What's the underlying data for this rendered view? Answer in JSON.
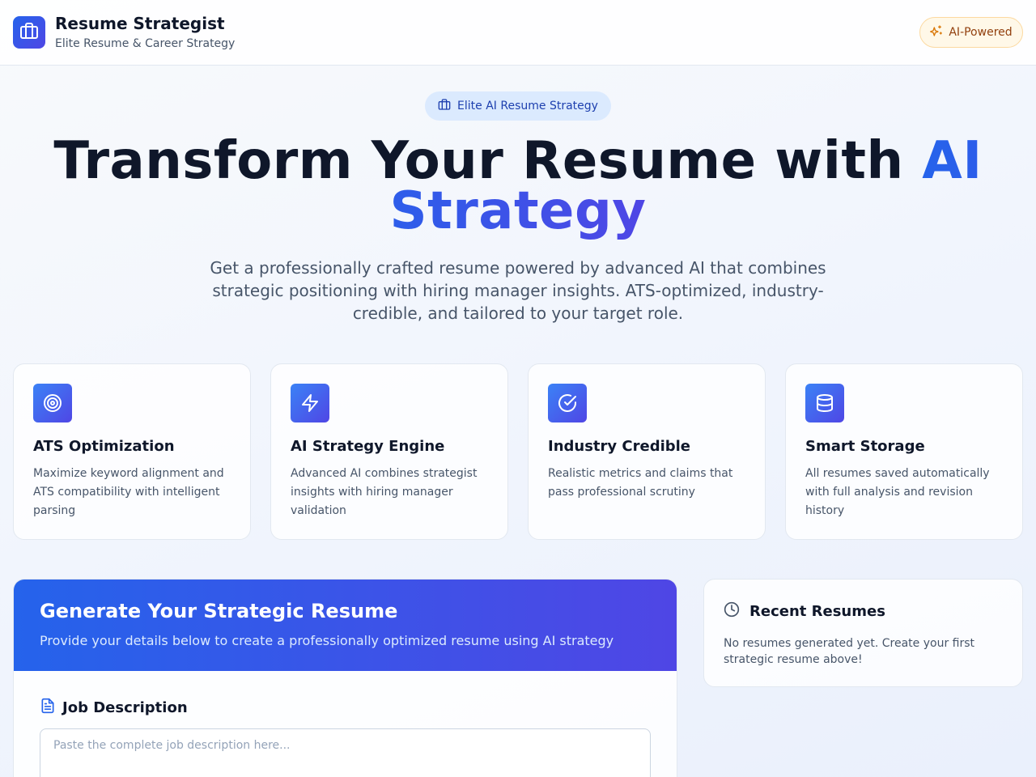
{
  "header": {
    "title": "Resume Strategist",
    "subtitle": "Elite Resume & Career Strategy",
    "badge": "AI-Powered",
    "logo_icon": "briefcase-icon",
    "badge_icon": "sparkles-icon"
  },
  "hero": {
    "pill": "Elite AI Resume Strategy",
    "pill_icon": "briefcase-icon",
    "title_main": "Transform Your Resume with ",
    "title_accent": "AI Strategy",
    "description": "Get a professionally crafted resume powered by advanced AI that combines strategic positioning with hiring manager insights. ATS-optimized, industry-credible, and tailored to your target role."
  },
  "features": [
    {
      "icon": "target-icon",
      "title": "ATS Optimization",
      "description": "Maximize keyword alignment and ATS compatibility with intelligent parsing"
    },
    {
      "icon": "zap-icon",
      "title": "AI Strategy Engine",
      "description": "Advanced AI combines strategist insights with hiring manager validation"
    },
    {
      "icon": "check-circle-icon",
      "title": "Industry Credible",
      "description": "Realistic metrics and claims that pass professional scrutiny"
    },
    {
      "icon": "database-icon",
      "title": "Smart Storage",
      "description": "All resumes saved automatically with full analysis and revision history"
    }
  ],
  "generate": {
    "title": "Generate Your Strategic Resume",
    "subtitle": "Provide your details below to create a professionally optimized resume using AI strategy",
    "job_description_label": "Job Description",
    "job_description_placeholder": "Paste the complete job description here...",
    "job_description_value": ""
  },
  "recent": {
    "title": "Recent Resumes",
    "empty_text": "No resumes generated yet. Create your first strategic resume above!"
  },
  "colors": {
    "accent_blue": "#2563eb",
    "accent_indigo": "#4f46e5",
    "badge_amber": "#92400e"
  }
}
